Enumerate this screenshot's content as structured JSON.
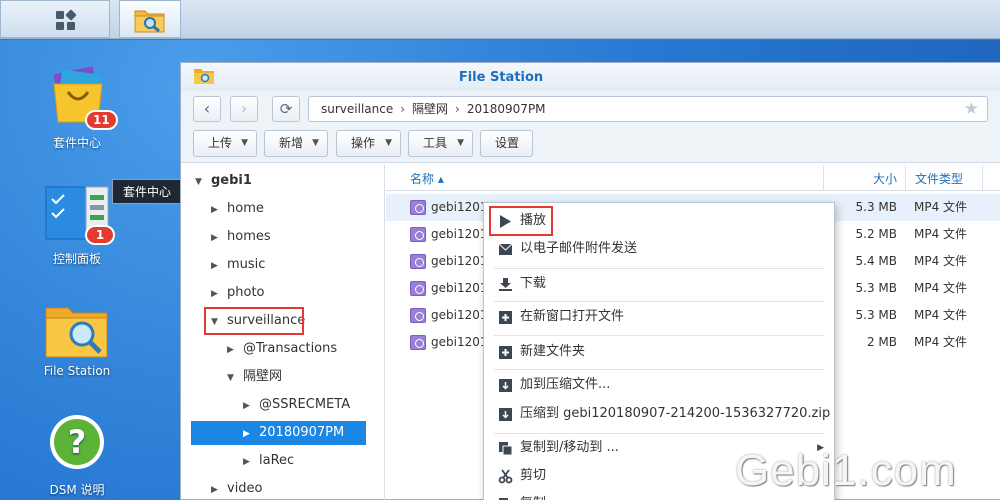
{
  "taskbar": {
    "main_menu_icon": "grid-icon",
    "file_station_icon": "folder-search-icon"
  },
  "desktop": {
    "icons": [
      {
        "label": "套件中心",
        "badge": "11",
        "icon": "package-center-icon"
      },
      {
        "label": "控制面板",
        "badge": "1",
        "icon": "control-panel-icon"
      },
      {
        "label": "File Station",
        "icon": "file-station-icon"
      },
      {
        "label": "DSM 说明",
        "icon": "help-icon"
      }
    ],
    "tooltip": "套件中心"
  },
  "window": {
    "title": "File Station",
    "path": [
      "surveillance",
      "隔壁网",
      "20180907PM"
    ],
    "toolbar": {
      "upload": "上传",
      "new": "新增",
      "action": "操作",
      "tools": "工具",
      "settings": "设置"
    },
    "tree": {
      "root": "gebi1",
      "items": [
        "home",
        "homes",
        "music",
        "photo",
        "surveillance",
        "@Transactions",
        "隔壁网",
        "@SSRECMETA",
        "20180907PM",
        "laRec",
        "video"
      ]
    },
    "columns": {
      "name": "名称 ▴",
      "size": "大小",
      "type": "文件类型"
    },
    "files": [
      {
        "name": "gebi1201",
        "size": "5.3 MB",
        "type": "MP4 文件"
      },
      {
        "name": "gebi1201",
        "size": "5.2 MB",
        "type": "MP4 文件"
      },
      {
        "name": "gebi1201",
        "size": "5.4 MB",
        "type": "MP4 文件"
      },
      {
        "name": "gebi1201",
        "size": "5.3 MB",
        "type": "MP4 文件"
      },
      {
        "name": "gebi1201",
        "size": "5.3 MB",
        "type": "MP4 文件"
      },
      {
        "name": "gebi1201",
        "size": "2 MB",
        "type": "MP4 文件"
      }
    ]
  },
  "context_menu": {
    "items": [
      {
        "label": "播放",
        "icon": "play-icon"
      },
      {
        "label": "以电子邮件附件发送",
        "icon": "mail-icon"
      },
      {
        "label": "下载",
        "icon": "download-icon"
      },
      {
        "label": "在新窗口打开文件",
        "icon": "new-window-icon"
      },
      {
        "label": "新建文件夹",
        "icon": "new-folder-icon"
      },
      {
        "label": "加到压缩文件...",
        "icon": "archive-add-icon"
      },
      {
        "label": "压缩到 gebi120180907-214200-1536327720.zip",
        "icon": "compress-icon"
      },
      {
        "label": "复制到/移动到 ...",
        "icon": "copy-icon"
      },
      {
        "label": "剪切",
        "icon": "scissors-icon"
      },
      {
        "label": "复制",
        "icon": "copy-icon"
      }
    ]
  },
  "watermark": "Gebi1.com",
  "colors": {
    "accent": "#1b87e3",
    "highlight_box": "#e53935",
    "desktop": "#2a7dd6"
  }
}
